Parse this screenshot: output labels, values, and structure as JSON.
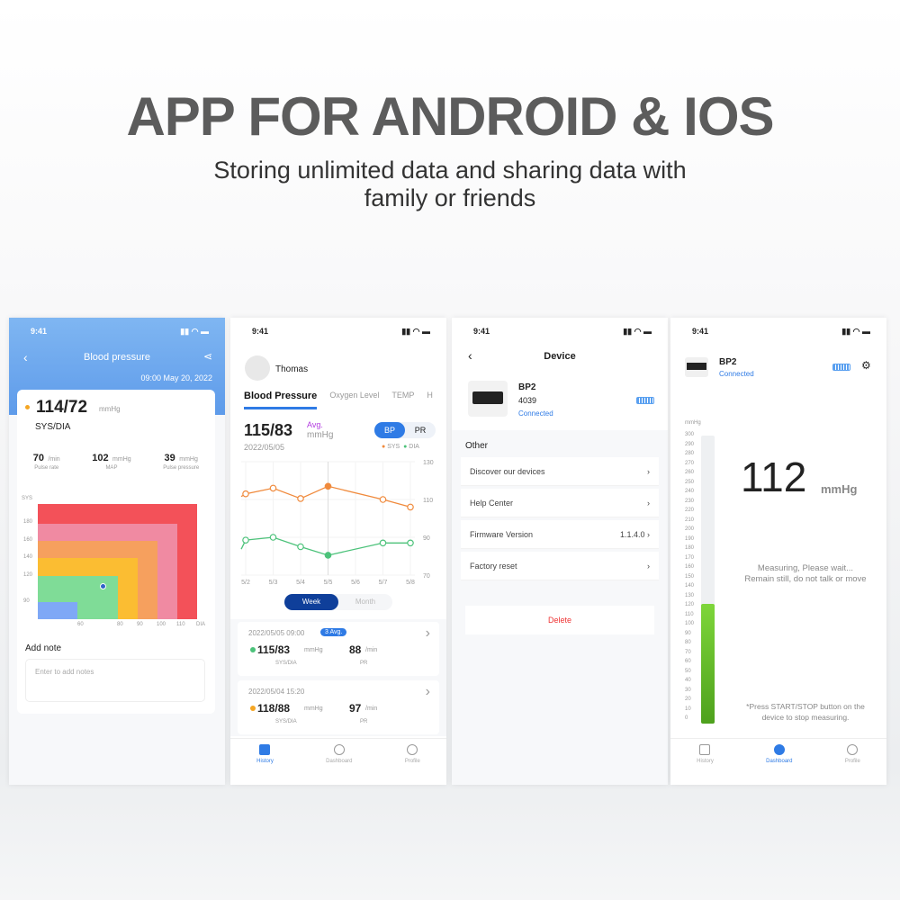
{
  "hero": {
    "title": "APP FOR ANDROID & IOS",
    "subtitle_1": "Storing unlimited data and sharing data with",
    "subtitle_2": "family or friends"
  },
  "colors": {
    "accent": "#2f7be5",
    "sys": "#f08a3c",
    "dia": "#4cc27a",
    "gauge": "#5cbf2a"
  },
  "status_time": "9:41",
  "screen1": {
    "title": "Blood pressure",
    "datetime": "09:00 May 20, 2022",
    "reading": "114/72",
    "unit": "mmHg",
    "reading_label": "SYS/DIA",
    "stats": [
      {
        "value": "70",
        "unit": "/min",
        "label": "Pulse rate"
      },
      {
        "value": "102",
        "unit": "mmHg",
        "label": "MAP"
      },
      {
        "value": "39",
        "unit": "mmHg",
        "label": "Pulse pressure"
      }
    ],
    "chart": {
      "y_title": "SYS",
      "y_ticks": [
        "180",
        "160",
        "140",
        "120",
        "90"
      ],
      "x_ticks": [
        "60",
        "80",
        "90",
        "100",
        "110"
      ],
      "x_title": "DIA"
    },
    "note_label": "Add note",
    "note_placeholder": "Enter to add notes"
  },
  "screen2": {
    "user": "Thomas",
    "tabs": [
      "Blood Pressure",
      "Oxygen Level",
      "TEMP",
      "H"
    ],
    "avg_value": "115/83",
    "avg_label": "Avg.",
    "unit": "mmHg",
    "date": "2022/05/05",
    "toggle": [
      "BP",
      "PR"
    ],
    "legend": [
      "SYS",
      "DIA"
    ],
    "period": [
      "Week",
      "Month"
    ],
    "records": [
      {
        "time": "2022/05/05 09:00",
        "badge_count": "3",
        "badge": "Avg.",
        "bp": "115/83",
        "unit": "mmHg",
        "bp_label": "SYS/DIA",
        "pr": "88",
        "pr_unit": "/min",
        "pr_label": "PR",
        "dot": "#4cc27a"
      },
      {
        "time": "2022/05/04 15:20",
        "bp": "118/88",
        "unit": "mmHg",
        "bp_label": "SYS/DIA",
        "pr": "97",
        "pr_unit": "/min",
        "pr_label": "PR",
        "dot": "#f5a623"
      }
    ]
  },
  "chart_data": {
    "type": "line",
    "categories": [
      "5/2",
      "5/3",
      "5/4",
      "5/5",
      "5/6",
      "5/7",
      "5/8"
    ],
    "y_ticks": [
      "130",
      "110",
      "90",
      "70"
    ],
    "ylim": [
      70,
      130
    ],
    "series": [
      {
        "name": "SYS",
        "values": [
          113,
          116,
          110.5,
          117,
          null,
          110,
          106
        ]
      },
      {
        "name": "DIA",
        "values": [
          88.5,
          90,
          85,
          80.5,
          null,
          87,
          87
        ]
      }
    ],
    "highlight": "5/5",
    "grid": true
  },
  "tabbar": [
    "History",
    "Dashboard",
    "Profile"
  ],
  "screen3": {
    "title": "Device",
    "device_name": "BP2",
    "device_id": "4039",
    "device_status": "Connected",
    "section": "Other",
    "items": [
      {
        "label": "Discover our devices",
        "value": ""
      },
      {
        "label": "Help Center",
        "value": ""
      },
      {
        "label": "Firmware Version",
        "value": "1.1.4.0"
      },
      {
        "label": "Factory reset",
        "value": ""
      }
    ],
    "delete": "Delete"
  },
  "screen4": {
    "device_name": "BP2",
    "device_status": "Connected",
    "gauge_unit": "mmHg",
    "gauge_ticks": [
      "300",
      "290",
      "280",
      "270",
      "260",
      "250",
      "240",
      "230",
      "220",
      "210",
      "200",
      "190",
      "180",
      "170",
      "160",
      "150",
      "140",
      "130",
      "120",
      "110",
      "100",
      "90",
      "80",
      "70",
      "60",
      "50",
      "40",
      "30",
      "20",
      "10",
      "0"
    ],
    "gauge_level": 125,
    "gauge_max": 300,
    "value": "112",
    "unit": "mmHg",
    "msg_1": "Measuring, Please wait...",
    "msg_2": "Remain still, do not talk or move",
    "hint_1": "*Press START/STOP button on the",
    "hint_2": "device to stop measuring."
  }
}
